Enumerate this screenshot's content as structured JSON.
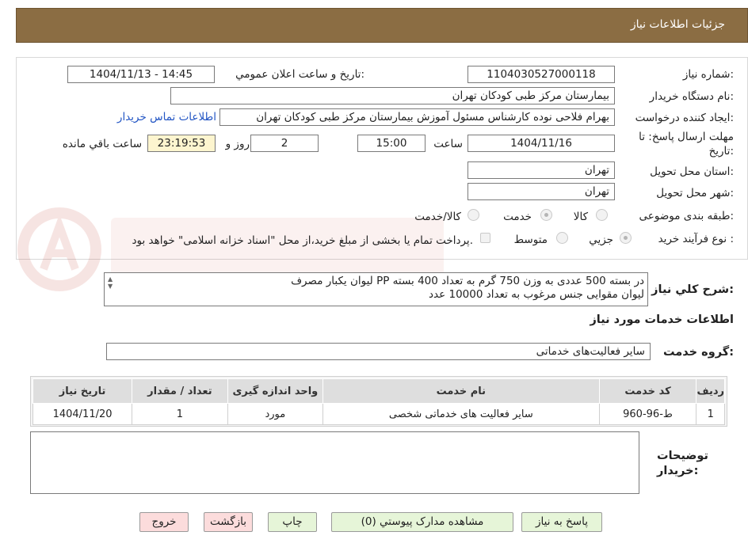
{
  "header": {
    "title": "جزئیات اطلاعات نیاز"
  },
  "need_number": {
    "label": "شماره نیاز:",
    "value": "1104030527000118"
  },
  "announce": {
    "label": "تاریخ و ساعت اعلان عمومي:",
    "value": "1404/11/13 - 14:45"
  },
  "buyer_org": {
    "label": "نام دستگاه خریدار:",
    "value": "بیمارستان مرکز طبی کودکان تهران"
  },
  "requester": {
    "label": "ایجاد کننده درخواست:",
    "value": "بهرام فلاحی نوده کارشناس مسئول آموزش بیمارستان مرکز طبی کودکان تهران",
    "contact_link": "اطلاعات تماس خریدار"
  },
  "deadline": {
    "label": "مهلت ارسال پاسخ: تا تاریخ:",
    "date": "1404/11/16",
    "time_label": "ساعت",
    "time": "15:00",
    "days": "2",
    "days_label": "روز و",
    "remaining": "23:19:53",
    "remaining_label": "ساعت باقي مانده"
  },
  "province": {
    "label": "استان محل تحویل:",
    "value": "تهران"
  },
  "city": {
    "label": "شهر محل تحویل:",
    "value": "تهران"
  },
  "category": {
    "label": "طبقه بندی موضوعی:",
    "options": [
      "کالا",
      "خدمت",
      "کالا/خدمت"
    ],
    "selected": "خدمت"
  },
  "process": {
    "label": "نوع فرآیند خرید :",
    "options": [
      "جزیي",
      "متوسط"
    ],
    "selected": "جزیي",
    "note": "پرداخت تمام یا بخشی از مبلغ خرید،از محل \"اسناد خزانه اسلامی\" خواهد بود."
  },
  "description": {
    "label": "شرح کلي نیاز:",
    "lines": [
      "لیوان یکبار مصرف PP  در بسته 500 عددی به وزن 750 گرم به تعداد 400 بسته",
      "لیوان مقوایی جنس مرغوب به تعداد 10000 عدد"
    ]
  },
  "services": {
    "title": "اطلاعات خدمات مورد نیاز",
    "group_label": "گروه خدمت:",
    "group_value": "سایر فعالیت‌های خدماتی",
    "columns": [
      "ردیف",
      "کد خدمت",
      "نام خدمت",
      "واحد اندازه گیری",
      "تعداد / مقدار",
      "تاریخ نیاز"
    ],
    "rows": [
      [
        "1",
        "ط-96-960",
        "سایر فعالیت های خدماتی شخصی",
        "مورد",
        "1",
        "1404/11/20"
      ]
    ]
  },
  "buyer_notes": {
    "label": "توضیحات خریدار:",
    "value": ""
  },
  "buttons": {
    "reply": "پاسخ به نیاز",
    "docs": "مشاهده مدارک پیوستي (0)",
    "print": "چاپ",
    "back": "بازگشت",
    "exit": "خروج"
  },
  "colors": {
    "header": "#8b6d43",
    "remaining_bg": "#fdf5cf",
    "link": "#2255c4",
    "button_green": "#e6f5d8",
    "button_pink": "#fcdcdc"
  }
}
